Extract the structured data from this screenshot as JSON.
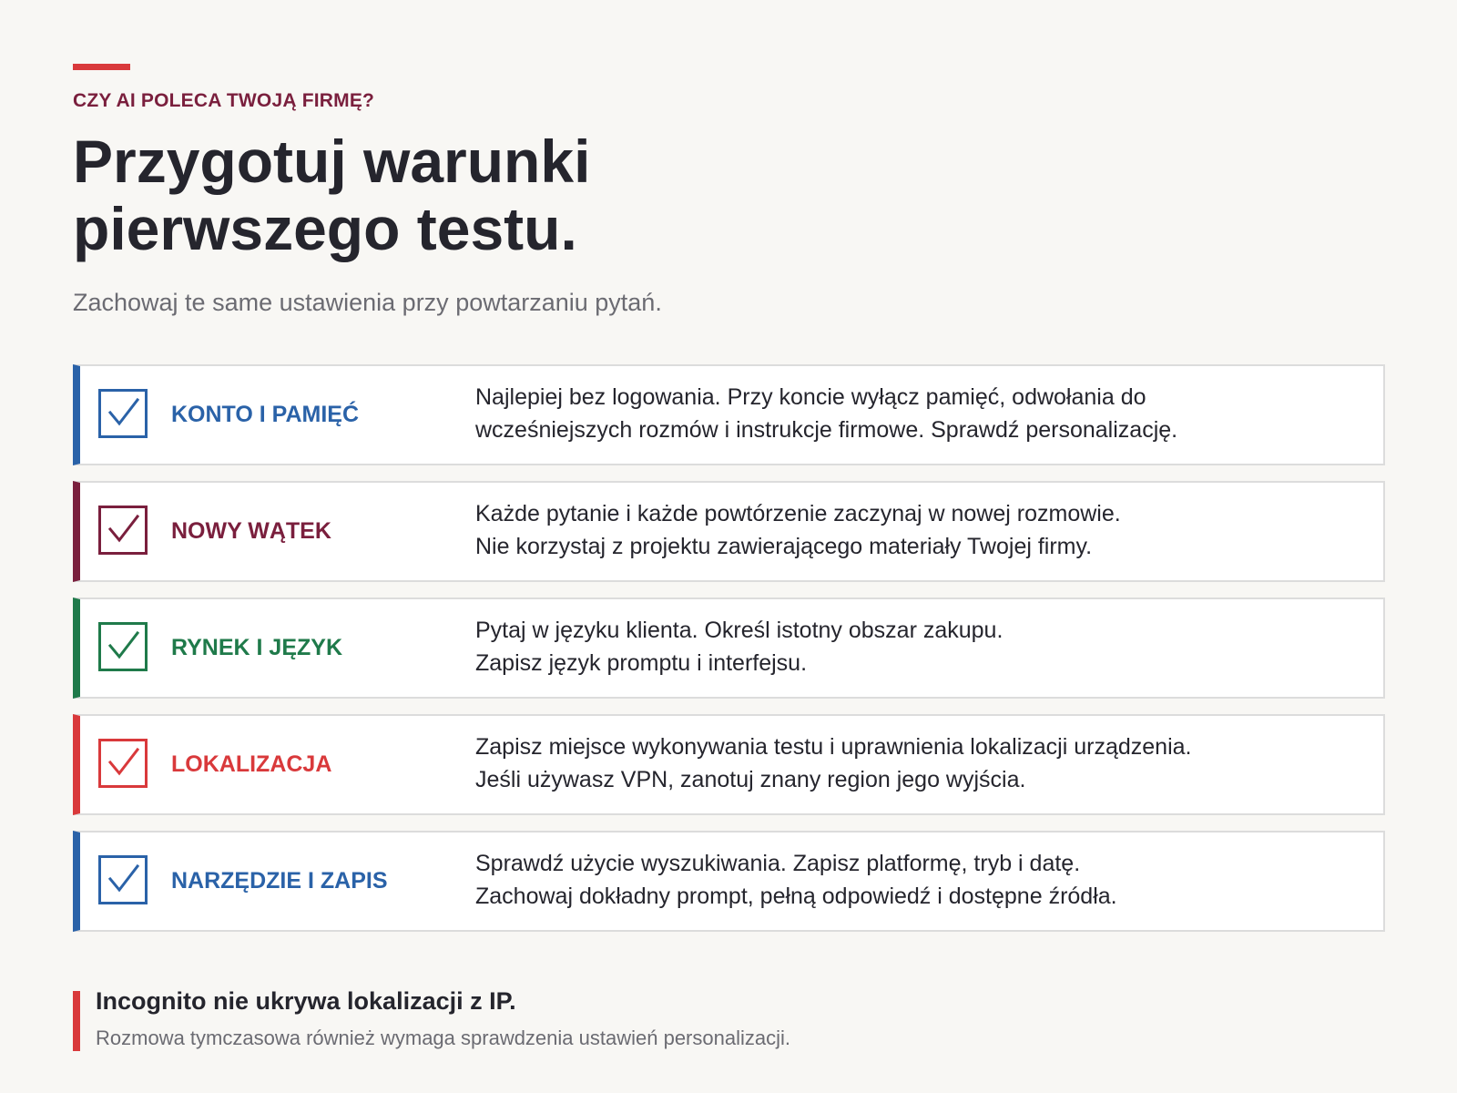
{
  "header": {
    "eyebrow": "CZY AI POLECA TWOJĄ FIRMĘ?",
    "title_line1": "Przygotuj warunki",
    "title_line2": "pierwszego testu.",
    "subtitle": "Zachowaj te same ustawienia przy powtarzaniu pytań."
  },
  "colors": {
    "accent_red": "#d9393b",
    "blue": "#2a62a8",
    "maroon": "#7a1f3d",
    "green": "#1f7a4a",
    "red": "#d9393b"
  },
  "checklist": {
    "items": [
      {
        "label": "KONTO I PAMIĘĆ",
        "color": "#2a62a8",
        "icon": "check-icon",
        "line1": "Najlepiej bez logowania. Przy koncie wyłącz pamięć, odwołania do",
        "line2": "wcześniejszych rozmów i instrukcje firmowe. Sprawdź personalizację."
      },
      {
        "label": "NOWY WĄTEK",
        "color": "#7a1f3d",
        "icon": "check-icon",
        "line1": "Każde pytanie i każde powtórzenie zaczynaj w nowej rozmowie.",
        "line2": "Nie korzystaj z projektu zawierającego materiały Twojej firmy."
      },
      {
        "label": "RYNEK I JĘZYK",
        "color": "#1f7a4a",
        "icon": "check-icon",
        "line1": "Pytaj w języku klienta. Określ istotny obszar zakupu.",
        "line2": "Zapisz język promptu i interfejsu."
      },
      {
        "label": "LOKALIZACJA",
        "color": "#d9393b",
        "icon": "check-icon",
        "line1": "Zapisz miejsce wykonywania testu i uprawnienia lokalizacji urządzenia.",
        "line2": "Jeśli używasz VPN, zanotuj znany region jego wyjścia."
      },
      {
        "label": "NARZĘDZIE I ZAPIS",
        "color": "#2a62a8",
        "icon": "check-icon",
        "line1": "Sprawdź użycie wyszukiwania. Zapisz platformę, tryb i datę.",
        "line2": "Zachowaj dokładny prompt, pełną odpowiedź i dostępne źródła."
      }
    ]
  },
  "note": {
    "title": "Incognito nie ukrywa lokalizacji z IP.",
    "text": "Rozmowa tymczasowa również wymaga sprawdzenia ustawień personalizacji."
  }
}
